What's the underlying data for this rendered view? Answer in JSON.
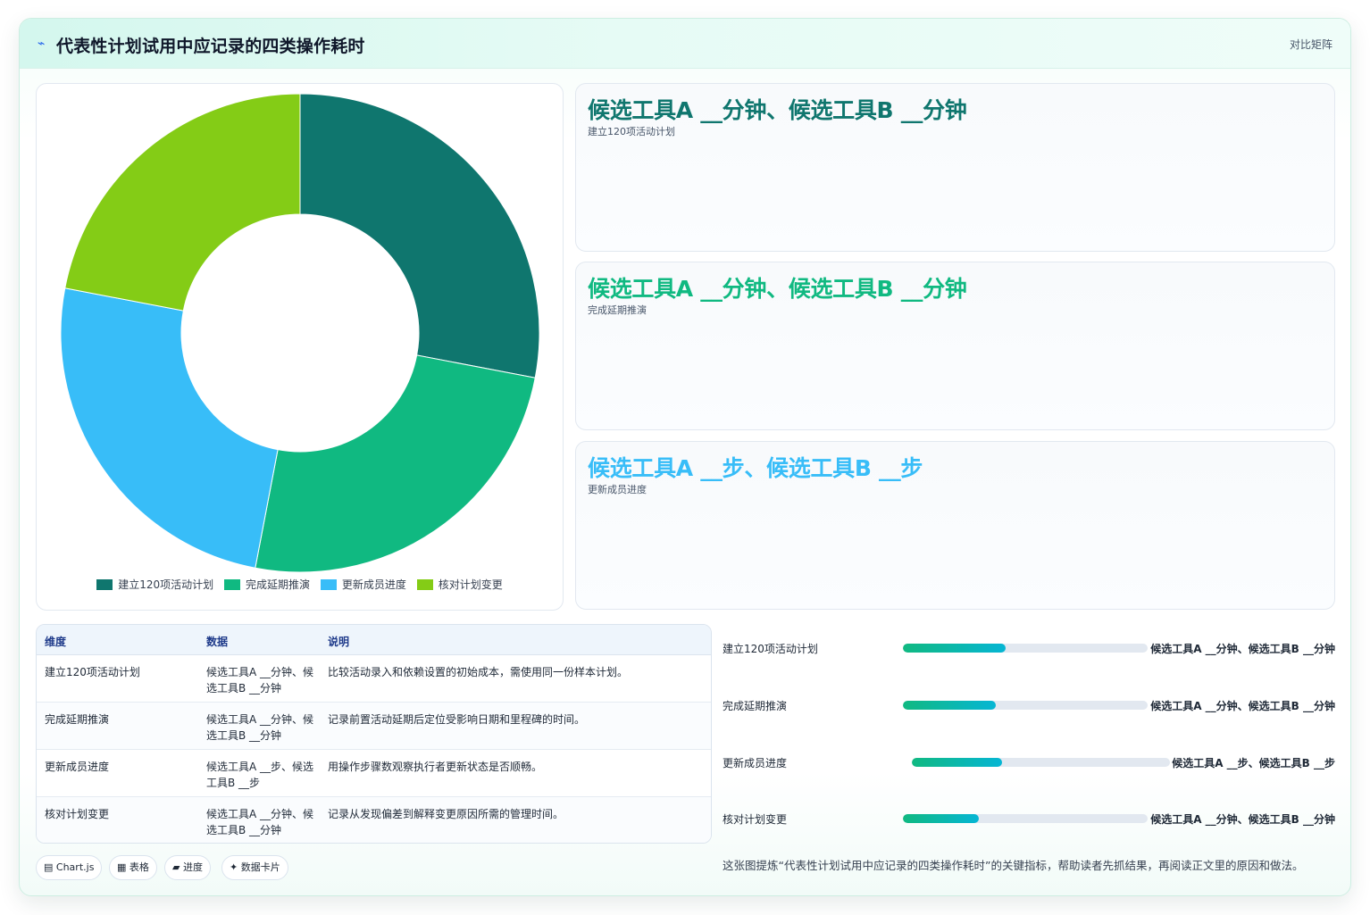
{
  "header": {
    "title_icon": "chart-spark-icon",
    "title": "代表性计划试用中应记录的四类操作耗时",
    "badge": "对比矩阵"
  },
  "chart_data": {
    "type": "donut",
    "categories": [
      "建立120项活动计划",
      "完成延期推演",
      "更新成员进度",
      "核对计划变更"
    ],
    "values": [
      28,
      25,
      25,
      22
    ],
    "colors": [
      "#0f766e",
      "#10b981",
      "#38bdf8",
      "#84cc16"
    ],
    "legend_position": "bottom"
  },
  "metrics": [
    {
      "value": "候选工具A __分钟、候选工具B __分钟",
      "label": "建立120项活动计划",
      "color": "#0f766e"
    },
    {
      "value": "候选工具A __分钟、候选工具B __分钟",
      "label": "完成延期推演",
      "color": "#10b981"
    },
    {
      "value": "候选工具A __步、候选工具B __步",
      "label": "更新成员进度",
      "color": "#38bdf8"
    }
  ],
  "table": {
    "headers": [
      "维度",
      "数据",
      "说明"
    ],
    "rows": [
      [
        "建立120项活动计划",
        "候选工具A __分钟、候选工具B __分钟",
        "比较活动录入和依赖设置的初始成本，需使用同一份样本计划。"
      ],
      [
        "完成延期推演",
        "候选工具A __分钟、候选工具B __分钟",
        "记录前置活动延期后定位受影响日期和里程碑的时间。"
      ],
      [
        "更新成员进度",
        "候选工具A __步、候选工具B __步",
        "用操作步骤数观察执行者更新状态是否顺畅。"
      ],
      [
        "核对计划变更",
        "候选工具A __分钟、候选工具B __分钟",
        "记录从发现偏差到解释变更原因所需的管理时间。"
      ]
    ]
  },
  "progress": [
    {
      "label": "建立120项活动计划",
      "value": "候选工具A __分钟、候选工具B __分钟",
      "fraction": 0.42
    },
    {
      "label": "完成延期推演",
      "value": "候选工具A __分钟、候选工具B __分钟",
      "fraction": 0.38
    },
    {
      "label": "更新成员进度",
      "value": "候选工具A __步、候选工具B __步",
      "fraction": 0.35
    },
    {
      "label": "核对计划变更",
      "value": "候选工具A __分钟、候选工具B __分钟",
      "fraction": 0.31
    }
  ],
  "tags": [
    {
      "icon": "chart-icon",
      "glyph": "▤",
      "label": "Chart.js"
    },
    {
      "icon": "table-icon",
      "glyph": "▦",
      "label": "表格"
    },
    {
      "icon": "progress-icon",
      "glyph": "▰",
      "label": "进度"
    },
    {
      "icon": "card-icon",
      "glyph": "✦",
      "label": "数据卡片"
    }
  ],
  "summary": "这张图提炼“代表性计划试用中应记录的四类操作耗时”的关键指标，帮助读者先抓结果，再阅读正文里的原因和做法。"
}
